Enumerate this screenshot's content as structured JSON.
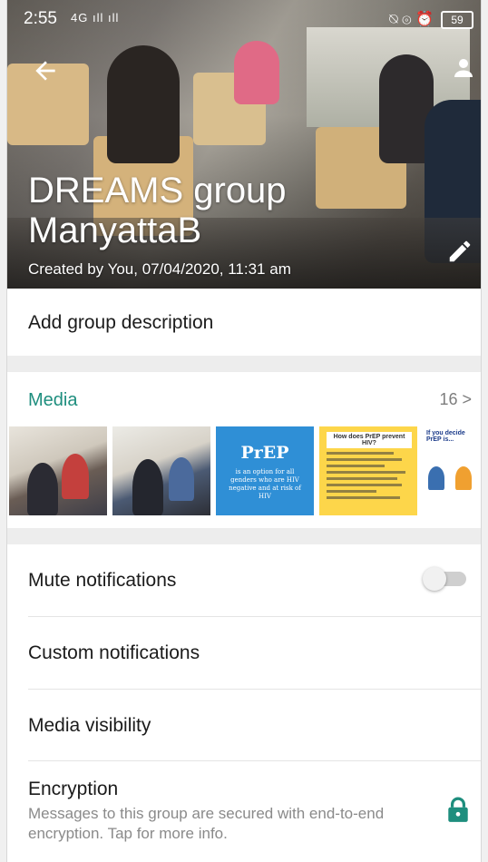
{
  "status_bar": {
    "time": "2:55",
    "signal": "4G ıll ıll",
    "icons": "⍉ ⊚ ⏰",
    "battery": "59"
  },
  "header": {
    "group_name": "DREAMS group ManyattaB",
    "created": "Created by You, 07/04/2020, 11:31 am",
    "back_icon": "arrow-left-icon",
    "edit_icon": "pencil-icon",
    "person_icon": "person-icon"
  },
  "description": {
    "label": "Add group description"
  },
  "media": {
    "title": "Media",
    "count": "16 >",
    "thumbs": [
      {
        "type": "photo"
      },
      {
        "type": "photo"
      },
      {
        "type": "poster",
        "title": "PrEP",
        "text": "is an option for all genders who are HIV negative and at risk of HIV"
      },
      {
        "type": "poster",
        "title": "How does PrEP prevent HIV?"
      },
      {
        "type": "poster",
        "title": "If you decide PrEP is..."
      }
    ]
  },
  "settings": {
    "mute": "Mute notifications",
    "mute_enabled": false,
    "custom": "Custom notifications",
    "visibility": "Media visibility",
    "encryption": "Encryption",
    "encryption_sub": "Messages to this group are secured with end-to-end encryption. Tap for more info."
  },
  "colors": {
    "accent": "#1e8e7e",
    "divider": "#e4e4e4",
    "gap": "#ededed"
  }
}
